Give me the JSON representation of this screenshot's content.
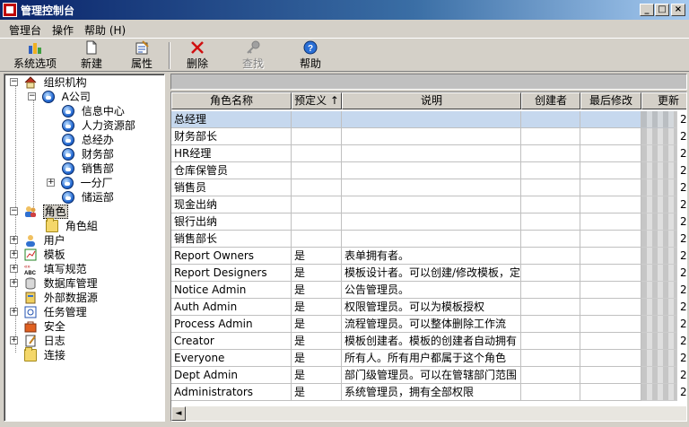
{
  "window": {
    "title": "管理控制台"
  },
  "menu": [
    "管理台",
    "操作",
    "帮助 (H)"
  ],
  "toolbar": {
    "buttons": [
      {
        "label": "系统选项",
        "icon": "system-options-icon",
        "enabled": true
      },
      {
        "label": "新建",
        "icon": "new-document-icon",
        "enabled": true
      },
      {
        "label": "属性",
        "icon": "properties-icon",
        "enabled": true
      },
      {
        "label": "删除",
        "icon": "delete-icon",
        "enabled": true
      },
      {
        "label": "查找",
        "icon": "find-key-icon",
        "enabled": false
      },
      {
        "label": "帮助",
        "icon": "help-icon",
        "enabled": true
      }
    ]
  },
  "tree": {
    "org": "组织机构",
    "companyA": "A公司",
    "depts": [
      "信息中心",
      "人力资源部",
      "总经办",
      "财务部",
      "销售部",
      "一分厂",
      "储运部"
    ],
    "role": "角色",
    "roleGroup": "角色組",
    "others": [
      "用户",
      "模板",
      "填写规范",
      "数据库管理",
      "外部数据源",
      "任务管理",
      "安全",
      "日志",
      "连接"
    ]
  },
  "grid": {
    "headers": [
      "角色名称",
      "预定义 ↑",
      "说明",
      "创建者",
      "最后修改",
      "更新"
    ],
    "rows": [
      {
        "name": "总经理",
        "predefined": "",
        "desc": ""
      },
      {
        "name": "财务部长",
        "predefined": "",
        "desc": ""
      },
      {
        "name": "HR经理",
        "predefined": "",
        "desc": ""
      },
      {
        "name": "仓库保管员",
        "predefined": "",
        "desc": ""
      },
      {
        "name": "销售员",
        "predefined": "",
        "desc": ""
      },
      {
        "name": "现金出纳",
        "predefined": "",
        "desc": ""
      },
      {
        "name": "银行出纳",
        "predefined": "",
        "desc": ""
      },
      {
        "name": "销售部长",
        "predefined": "",
        "desc": ""
      },
      {
        "name": "Report Owners",
        "predefined": "是",
        "desc": "表单拥有者。"
      },
      {
        "name": "Report Designers",
        "predefined": "是",
        "desc": "模板设计者。可以创建/修改模板，定"
      },
      {
        "name": "Notice Admin",
        "predefined": "是",
        "desc": "公告管理员。"
      },
      {
        "name": "Auth Admin",
        "predefined": "是",
        "desc": "权限管理员。可以为模板授权"
      },
      {
        "name": "Process Admin",
        "predefined": "是",
        "desc": "流程管理员。可以整体删除工作流"
      },
      {
        "name": "Creator",
        "predefined": "是",
        "desc": "模板创建者。模板的创建者自动拥有"
      },
      {
        "name": "Everyone",
        "predefined": "是",
        "desc": "所有人。所有用户都属于这个角色"
      },
      {
        "name": "Dept Admin",
        "predefined": "是",
        "desc": "部门级管理员。可以在管辖部门范围"
      },
      {
        "name": "Administrators",
        "predefined": "是",
        "desc": "系统管理员，拥有全部权限"
      }
    ],
    "update_col_value": "2"
  }
}
